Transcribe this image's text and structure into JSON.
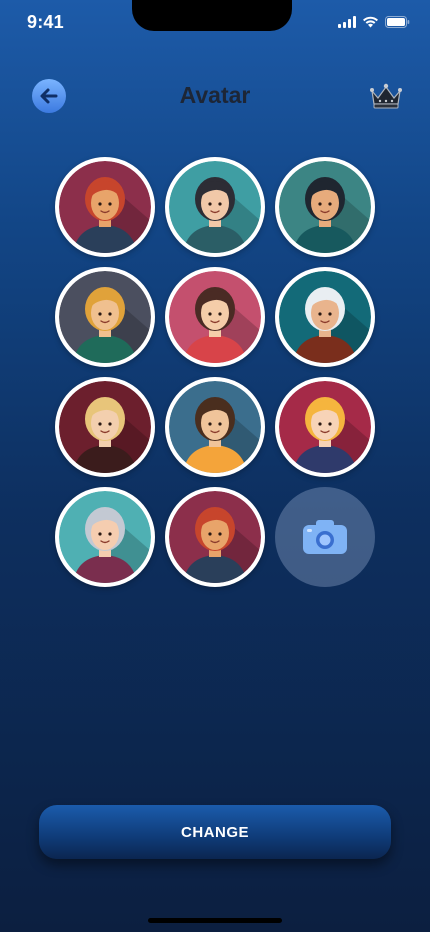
{
  "status_bar": {
    "time": "9:41",
    "icons": [
      "signal-icon",
      "wifi-icon",
      "battery-icon"
    ]
  },
  "header": {
    "title": "Avatar",
    "back_icon": "arrow-left-icon",
    "right_icon": "crown-icon"
  },
  "avatars": [
    {
      "name": "avatar-woman-red-hijab",
      "bg": "#8c2f4b",
      "skin": "#e8a46a",
      "hair": "#c7452c",
      "shirt": "#2a3f5a"
    },
    {
      "name": "avatar-man-dark-hair",
      "bg": "#3f9ea3",
      "skin": "#f1c8a8",
      "hair": "#2d2d35",
      "shirt": "#2b5e66"
    },
    {
      "name": "avatar-woman-long-dark-hair",
      "bg": "#3c8584",
      "skin": "#e7ab7c",
      "hair": "#1f2630",
      "shirt": "#17595e"
    },
    {
      "name": "avatar-man-blond",
      "bg": "#4b4f5f",
      "skin": "#f0c08f",
      "hair": "#e0a23a",
      "shirt": "#1f6b5a"
    },
    {
      "name": "avatar-girl-brown-hair",
      "bg": "#c4506e",
      "skin": "#f5cda9",
      "hair": "#4a2b24",
      "shirt": "#d84449"
    },
    {
      "name": "avatar-old-man-beard",
      "bg": "#136a78",
      "skin": "#e9b48d",
      "hair": "#e9eef2",
      "shirt": "#7a2e1c"
    },
    {
      "name": "avatar-woman-blonde-curly",
      "bg": "#6c1f2d",
      "skin": "#f3cfae",
      "hair": "#e8c57a",
      "shirt": "#3b1c1c"
    },
    {
      "name": "avatar-boy-brown-hair",
      "bg": "#3b6e8d",
      "skin": "#f0c49a",
      "hair": "#4a2e1e",
      "shirt": "#f4a43a"
    },
    {
      "name": "avatar-girl-blonde",
      "bg": "#a52a48",
      "skin": "#f7d3b7",
      "hair": "#f5b53e",
      "shirt": "#2f3a6b"
    },
    {
      "name": "avatar-grandma",
      "bg": "#4fb0b3",
      "skin": "#f5cdb0",
      "hair": "#c3c9d3",
      "shirt": "#7a2e4e"
    },
    {
      "name": "avatar-woman-red-hijab-2",
      "bg": "#8c2f4b",
      "skin": "#e8a46a",
      "hair": "#c7452c",
      "shirt": "#2a3f5a"
    }
  ],
  "upload": {
    "icon": "camera-icon"
  },
  "actions": {
    "change_label": "CHANGE"
  }
}
